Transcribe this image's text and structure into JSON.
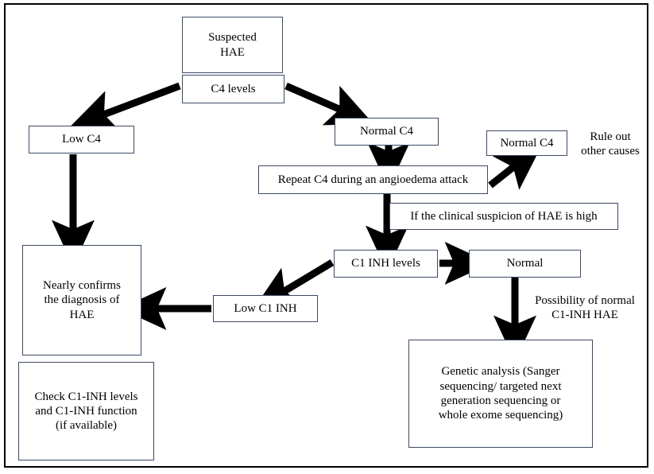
{
  "diagram": {
    "title": "HAE diagnostic algorithm flowchart",
    "border_color": "#000000",
    "node_border_color": "#3d4a66",
    "arrow_color": "#000000",
    "background": "#ffffff",
    "nodes": [
      {
        "id": "suspected-hae",
        "label": "Suspected\nHAE"
      },
      {
        "id": "c4-levels",
        "label": "C4 levels"
      },
      {
        "id": "low-c4",
        "label": "Low C4"
      },
      {
        "id": "normal-c4",
        "label": "Normal C4"
      },
      {
        "id": "repeat-c4",
        "label": "Repeat C4 during an angioedema attack"
      },
      {
        "id": "normal-c4-right",
        "label": "Normal C4"
      },
      {
        "id": "clinical-suspicion",
        "label": "If the clinical suspicion of HAE is high"
      },
      {
        "id": "c1-inh-levels",
        "label": "C1 INH levels"
      },
      {
        "id": "normal",
        "label": "Normal"
      },
      {
        "id": "low-c1-inh",
        "label": "Low C1 INH"
      },
      {
        "id": "nearly-confirms",
        "label": "Nearly confirms\nthe diagnosis of\nHAE"
      },
      {
        "id": "check-c1-inh",
        "label": "Check C1-INH levels\nand C1-INH function\n(if available)"
      },
      {
        "id": "genetic-analysis",
        "label": "Genetic analysis (Sanger\nsequencing/ targeted next\ngeneration sequencing or\nwhole exome sequencing)"
      }
    ],
    "labels": [
      {
        "id": "rule-out-other-causes",
        "text": "Rule out\nother causes"
      },
      {
        "id": "possibility-normal-c1inh-hae",
        "text": "Possibility of normal\nC1-INH HAE"
      }
    ],
    "edges": [
      {
        "from": "c4-levels",
        "to": "low-c4"
      },
      {
        "from": "c4-levels",
        "to": "normal-c4"
      },
      {
        "from": "low-c4",
        "to": "nearly-confirms"
      },
      {
        "from": "normal-c4",
        "to": "repeat-c4"
      },
      {
        "from": "repeat-c4",
        "to": "normal-c4-right"
      },
      {
        "from": "repeat-c4",
        "to": "c1-inh-levels"
      },
      {
        "from": "c1-inh-levels",
        "to": "low-c1-inh"
      },
      {
        "from": "c1-inh-levels",
        "to": "normal"
      },
      {
        "from": "low-c1-inh",
        "to": "nearly-confirms"
      },
      {
        "from": "normal",
        "to": "genetic-analysis"
      }
    ]
  }
}
